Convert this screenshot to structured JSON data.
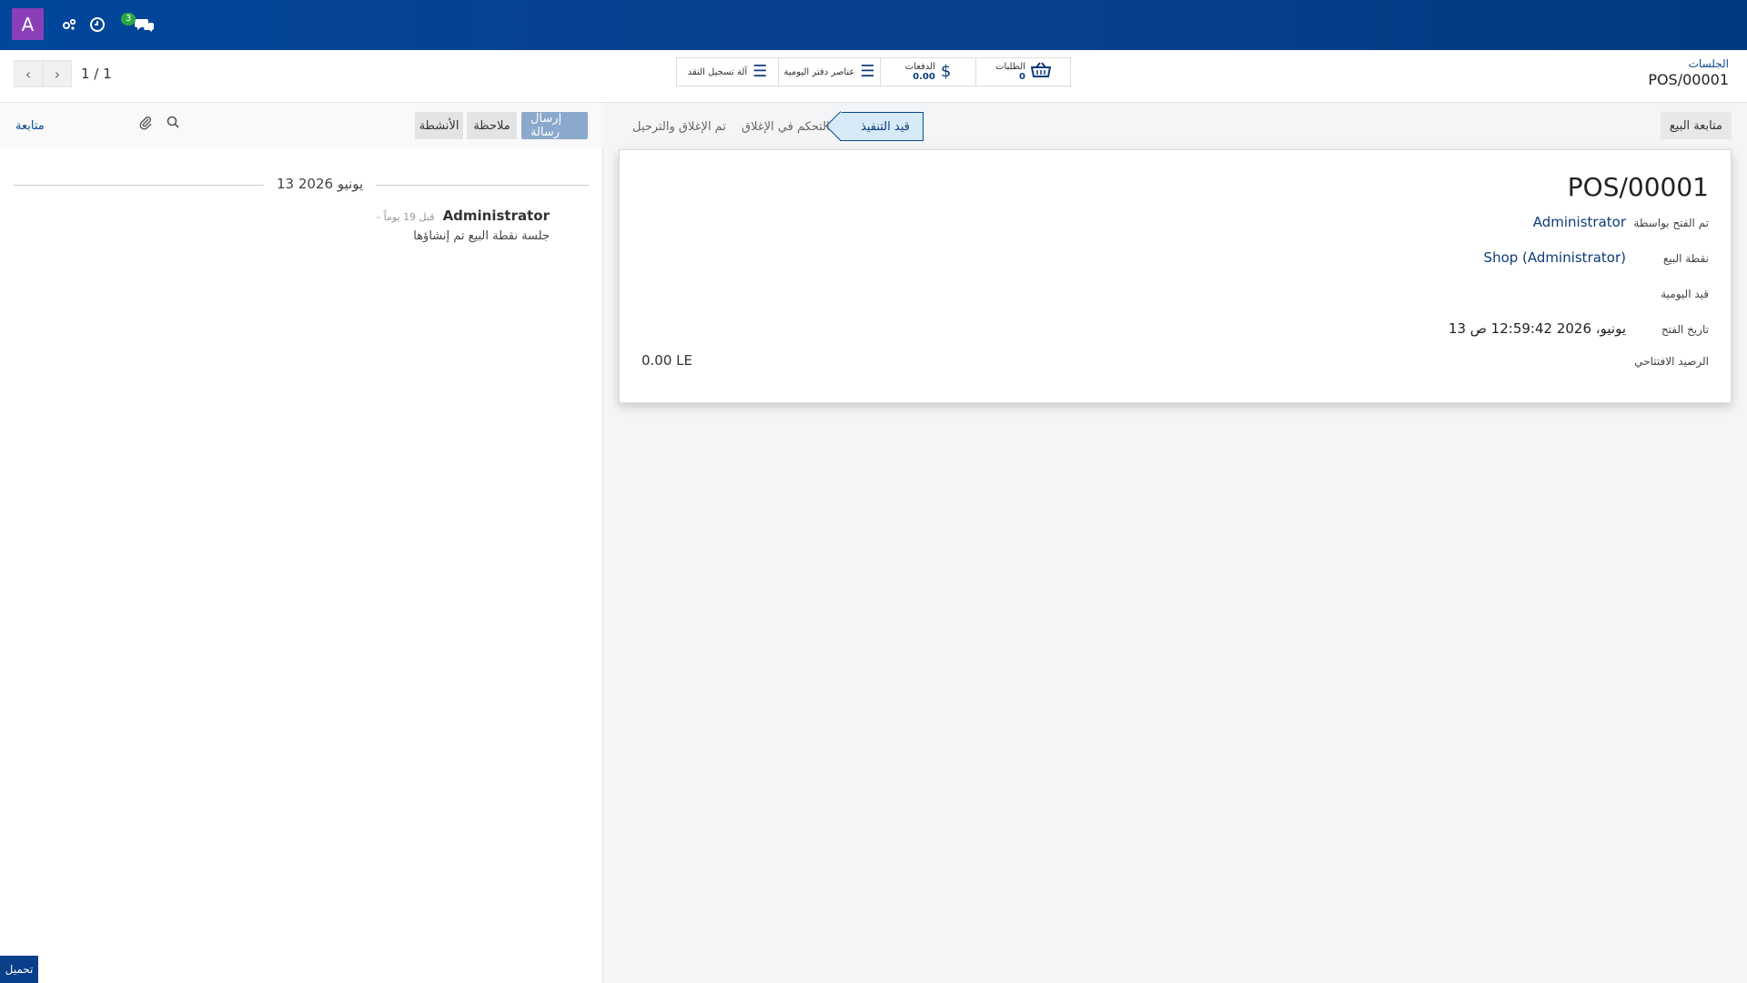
{
  "navbar": {
    "avatar_letter": "A",
    "messages_count": "3"
  },
  "breadcrumb": {
    "parent": "الجلسات",
    "current": "POS/00001"
  },
  "smart_buttons": {
    "orders_label": "الطلبات",
    "orders_value": "0",
    "payments_label": "الدفعات",
    "payments_value": "0.00",
    "journal_items_label": "عناصر دفتر اليومية",
    "cash_register_label": "آلة تسجيل النقد"
  },
  "pager": {
    "value": "1 / 1"
  },
  "chatter": {
    "follow_label": "متابعة",
    "send_message_label": "إرسال رسالة",
    "log_note_label": "ملاحظة",
    "activities_label": "الأنشطة",
    "date_separator": "13 يونيو 2026",
    "message": {
      "author": "Administrator",
      "ago": "- قبل 19 يوماً",
      "body": "جلسة نقطة البيع تم إنشاؤها"
    }
  },
  "statusbar": {
    "continue_selling_label": "متابعة البيع",
    "stages": [
      {
        "label": "قيد التنفيذ",
        "active": true
      },
      {
        "label": "التحكم في الإغلاق",
        "active": false
      },
      {
        "label": "تم الإغلاق والترحيل",
        "active": false
      }
    ]
  },
  "form": {
    "name": "POS/00001",
    "opened_by_label": "تم الفتح بواسطة",
    "opened_by_value": "Administrator",
    "pos_label": "نقطة البيع",
    "pos_value": "Shop (Administrator)",
    "journal_label": "قيد اليومية",
    "journal_value": "",
    "opening_date_label": "تاريخ الفتح",
    "opening_date_value": "13 يونيو، 2026 12:59:42 ص",
    "opening_balance_label": "الرصيد الافتتاحي",
    "opening_balance_value": "0.00 LE"
  },
  "download_label": "تحميل",
  "colors": {
    "navbar": "#00469b",
    "avatar": "#8a3fb8",
    "badge": "#28a745",
    "link": "#0d4b8f",
    "primary_button": "#8aa9cc",
    "active_stage": "#d6eaf8"
  }
}
